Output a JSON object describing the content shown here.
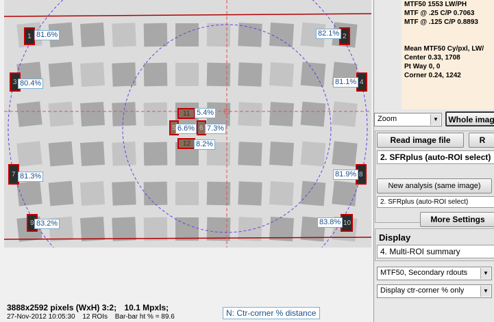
{
  "image_info": {
    "dims": "3888x2592 pixels (WxH) 3:2;",
    "mpxls": "10.1 Mpxls;",
    "timestamp": "27-Nov-2012 10:05:30",
    "roi_count": "12 ROIs",
    "bar_ht": "Bar-bar ht % = 89.6"
  },
  "legend": "N:  Ctr-corner % distance",
  "roi_labels": {
    "r1": "81.6%",
    "r2": "82.1%",
    "r3": "80.4%",
    "r4": "81.1%",
    "c11": "5.4%",
    "c5": "6.6%",
    "c6": "7.3%",
    "c12": "8.2%",
    "r7": "81.3%",
    "r8": "81.9%",
    "r9": "83.2%",
    "r10": "83.8%"
  },
  "roi_numbers": {
    "n1": "1",
    "n2": "2",
    "n3": "3",
    "n4": "4",
    "n5": "5",
    "n6": "6",
    "n7": "7",
    "n8": "8",
    "n9": "9",
    "n10": "10",
    "n11": "11",
    "n12": "12"
  },
  "results": {
    "mtf50": "MTF50  1553 LW/PH",
    "mtf25": "MTF @ .25 C/P  0.7063",
    "mtf125": "MTF @ .125 C/P  0.8893",
    "mean_header": "Mean MTF50 Cy/pxl, LW/",
    "center": "Center  0.33,  1708",
    "ptway": "Pt Way  0,  0",
    "corner": "Corner  0.24,  1242"
  },
  "controls": {
    "zoom_select": "Zoom",
    "whole_image": "Whole imag",
    "read_image_file": "Read image file",
    "r_button": "R",
    "analysis_field": "2. SFRplus (auto-ROI select)",
    "new_analysis": "New analysis (same image)",
    "analysis_select": "2. SFRplus (auto-ROI select)",
    "more_settings": "More Settings",
    "display_title": "Display",
    "display_field": "4.   Multi-ROI summary",
    "mtf_select": "MTF50, Secondary rdouts",
    "display_select": "Display ctr-corner % only"
  },
  "colors": {
    "results_bg": "#fbeedd",
    "roi_outline": "#c00000",
    "label_border": "#7aaed0",
    "guide_line": "#e05050",
    "circle": "#6a3de8"
  }
}
